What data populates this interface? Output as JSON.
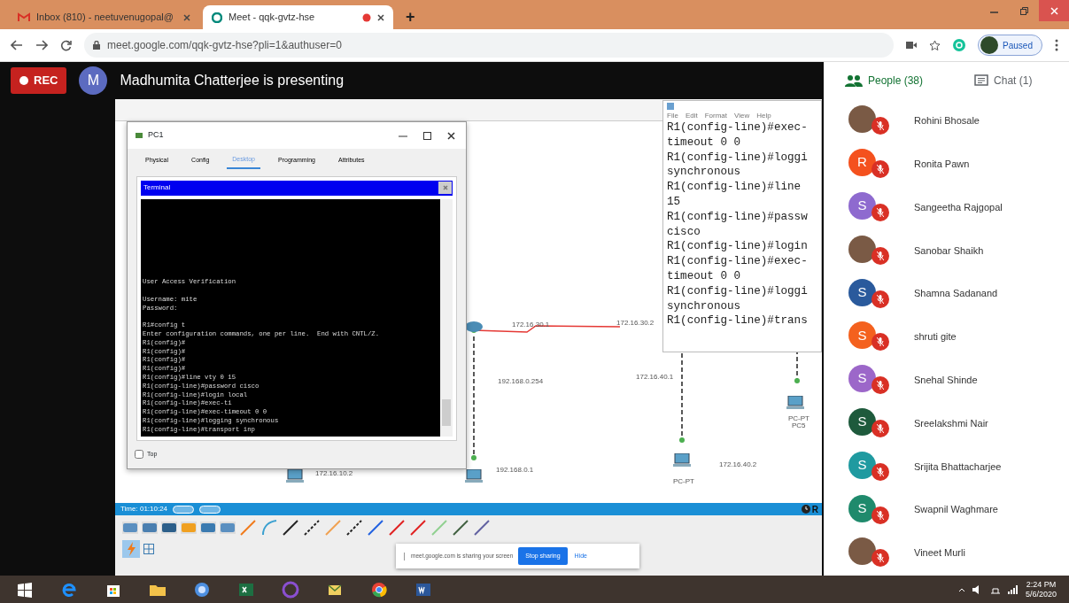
{
  "browser": {
    "tabs": [
      {
        "kind": "mail",
        "title": "Inbox (810) - neetuvenugopal@",
        "selected": false,
        "recording": false
      },
      {
        "kind": "meet",
        "title": "Meet - qqk-gvtz-hse",
        "selected": true,
        "recording": true
      }
    ],
    "new_tab": "+",
    "url": "meet.google.com/qqk-gvtz-hse?pli=1&authuser=0",
    "profile": "Paused"
  },
  "meet": {
    "rec": "REC",
    "presenter_initial": "M",
    "presenting": "Madhumita Chatterjee is presenting"
  },
  "packet_tracer": {
    "pc_window": {
      "title": "PC1",
      "tabs": [
        {
          "label": "Physical",
          "selected": false
        },
        {
          "label": "Config",
          "selected": false
        },
        {
          "label": "Desktop",
          "selected": true
        },
        {
          "label": "Programming",
          "selected": false
        },
        {
          "label": "Attributes",
          "selected": false
        }
      ],
      "terminal_title": "Terminal",
      "terminal_blocks": [
        [
          "User Access Verification"
        ],
        [
          "Username: mite",
          "Password:"
        ],
        [
          "R1#config t",
          "Enter configuration commands, one per line.  End with CNTL/Z.",
          "R1(config)#",
          "R1(config)#",
          "R1(config)#",
          "R1(config)#",
          "R1(config)#line vty 0 15",
          "R1(config-line)#password cisco",
          "R1(config-line)#login local",
          "R1(config-line)#exec-ti",
          "R1(config-line)#exec-timeout 0 0",
          "R1(config-line)#logging synchronous",
          "R1(config-line)#transport inp"
        ]
      ],
      "top_checkbox": {
        "label": "Top",
        "checked": false
      }
    },
    "notepad": {
      "menu": [
        "File",
        "Edit",
        "Format",
        "View",
        "Help"
      ],
      "lines": [
        "R1(config-line)#exec-",
        "timeout 0 0",
        "R1(config-line)#loggi",
        "synchronous",
        "R1(config-line)#line",
        "15",
        "R1(config-line)#passw",
        "cisco",
        "R1(config-line)#login",
        "R1(config-line)#exec-",
        "timeout 0 0",
        "R1(config-line)#loggi",
        "synchronous",
        "R1(config-line)#trans"
      ]
    },
    "canvas_labels": [
      "172.16.30.1",
      "172.16.30.2",
      "192.168.0.254",
      "172.16.40.1",
      "172.16.10.2",
      "192.168.0.1",
      "172.16.40.2",
      "PC-PT",
      "PC5",
      "PC-PT"
    ],
    "time": "Time: 01:10:24",
    "realtime": "R"
  },
  "share_bar": {
    "message": "meet.google.com is sharing your screen",
    "stop": "Stop sharing",
    "hide": "Hide"
  },
  "people_panel": {
    "tabs": [
      {
        "kind": "people",
        "label": "People (38)",
        "selected": true
      },
      {
        "kind": "chat",
        "label": "Chat (1)",
        "selected": false
      }
    ],
    "participants": [
      {
        "kind": "photo",
        "name": "Rohini Bhosale",
        "muted": true
      },
      {
        "kind": "letter",
        "initial": "R",
        "color": "#f4511e",
        "name": "Ronita Pawn",
        "muted": true
      },
      {
        "kind": "letter",
        "initial": "S",
        "color": "#8e6acf",
        "name": "Sangeetha Rajgopal",
        "muted": true
      },
      {
        "kind": "photo",
        "name": "Sanobar Shaikh",
        "muted": true
      },
      {
        "kind": "letter",
        "initial": "S",
        "color": "#2a5a9c",
        "name": "Shamna Sadanand",
        "muted": true
      },
      {
        "kind": "letter",
        "initial": "S",
        "color": "#f4611e",
        "name": "shruti gite",
        "muted": true
      },
      {
        "kind": "letter",
        "initial": "S",
        "color": "#9c67c9",
        "name": "Snehal Shinde",
        "muted": true
      },
      {
        "kind": "letter",
        "initial": "S",
        "color": "#1e5a3c",
        "name": "Sreelakshmi Nair",
        "muted": true
      },
      {
        "kind": "letter",
        "initial": "S",
        "color": "#1f9aa0",
        "name": "Srijita Bhattacharjee",
        "muted": true
      },
      {
        "kind": "letter",
        "initial": "S",
        "color": "#1f8a6c",
        "name": "Swapnil Waghmare",
        "muted": true
      },
      {
        "kind": "photo",
        "name": "Vineet Murli",
        "muted": true
      }
    ]
  },
  "taskbar": {
    "time": "2:24 PM",
    "date": "5/6/2020"
  }
}
